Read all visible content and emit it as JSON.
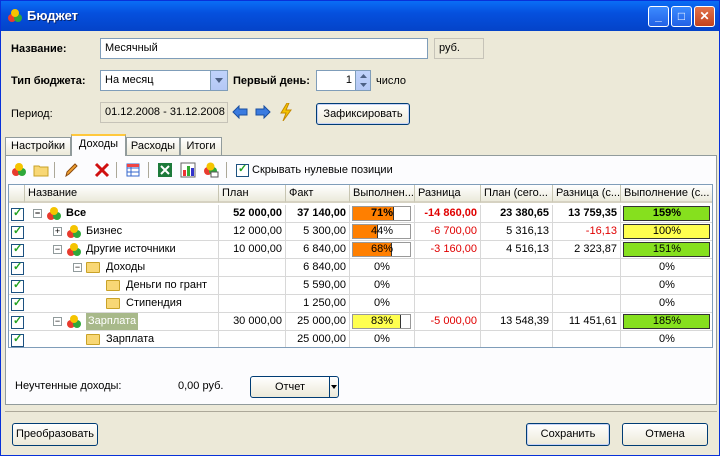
{
  "window": {
    "title": "Бюджет"
  },
  "form": {
    "name_label": "Название:",
    "name_value": "Месячный",
    "currency": "руб.",
    "type_label": "Тип бюджета:",
    "type_value": "На месяц",
    "first_day_label": "Первый день:",
    "first_day_value": "1",
    "first_day_unit": "число",
    "period_label": "Период:",
    "period_value": "01.12.2008 - 31.12.2008",
    "fix_button": "Зафиксировать"
  },
  "tabs": [
    "Настройки",
    "Доходы",
    "Расходы",
    "Итоги"
  ],
  "active_tab": 1,
  "toolbar": {
    "hide_zero_label": "Скрывать нулевые позиции",
    "hide_zero_checked": true
  },
  "table": {
    "columns": [
      "Название",
      "План",
      "Факт",
      "Выполнен...",
      "Разница",
      "План (сего...",
      "Разница (с...",
      "Выполнение (с..."
    ],
    "rows": [
      {
        "name": "Все",
        "plan": "52 000,00",
        "fact": "37 140,00",
        "perf": "71%",
        "perf_val": 0.71,
        "diff": "-14 860,00",
        "plan_today": "23 380,65",
        "diff_today": "13 759,35",
        "perf_today": "159%",
        "bold": true
      },
      {
        "name": "Бизнес",
        "plan": "12 000,00",
        "fact": "5 300,00",
        "perf": "44%",
        "perf_val": 0.44,
        "diff": "-6 700,00",
        "plan_today": "5 316,13",
        "diff_today": "-16,13",
        "perf_today": "100%"
      },
      {
        "name": "Другие источники",
        "plan": "10 000,00",
        "fact": "6 840,00",
        "perf": "68%",
        "perf_val": 0.68,
        "diff": "-3 160,00",
        "plan_today": "4 516,13",
        "diff_today": "2 323,87",
        "perf_today": "151%"
      },
      {
        "name": "Доходы",
        "plan": "",
        "fact": "6 840,00",
        "perf": "0%",
        "diff": "",
        "plan_today": "",
        "diff_today": "",
        "perf_today": "0%"
      },
      {
        "name": "Деньги по грант",
        "plan": "",
        "fact": "5 590,00",
        "perf": "0%",
        "diff": "",
        "plan_today": "",
        "diff_today": "",
        "perf_today": "0%"
      },
      {
        "name": "Стипендия",
        "plan": "",
        "fact": "1 250,00",
        "perf": "0%",
        "diff": "",
        "plan_today": "",
        "diff_today": "",
        "perf_today": "0%"
      },
      {
        "name": "Зарплата",
        "plan": "30 000,00",
        "fact": "25 000,00",
        "perf": "83%",
        "perf_val": 0.83,
        "diff": "-5 000,00",
        "plan_today": "13 548,39",
        "diff_today": "11 451,61",
        "perf_today": "185%"
      },
      {
        "name": "Зарплата",
        "plan": "",
        "fact": "25 000,00",
        "perf": "0%",
        "diff": "",
        "plan_today": "",
        "diff_today": "",
        "perf_today": "0%"
      }
    ]
  },
  "footer": {
    "unaccounted_label": "Неучтенные доходы:",
    "unaccounted_value": "0,00 руб.",
    "report_button": "Отчет",
    "convert_button": "Преобразовать",
    "save_button": "Сохранить",
    "cancel_button": "Отмена"
  },
  "colors": {
    "orange": "#ff7f00",
    "yellow": "#ffff4f",
    "green": "#86e01e",
    "red": "#e00000",
    "selected_row": "#a8b98a"
  }
}
